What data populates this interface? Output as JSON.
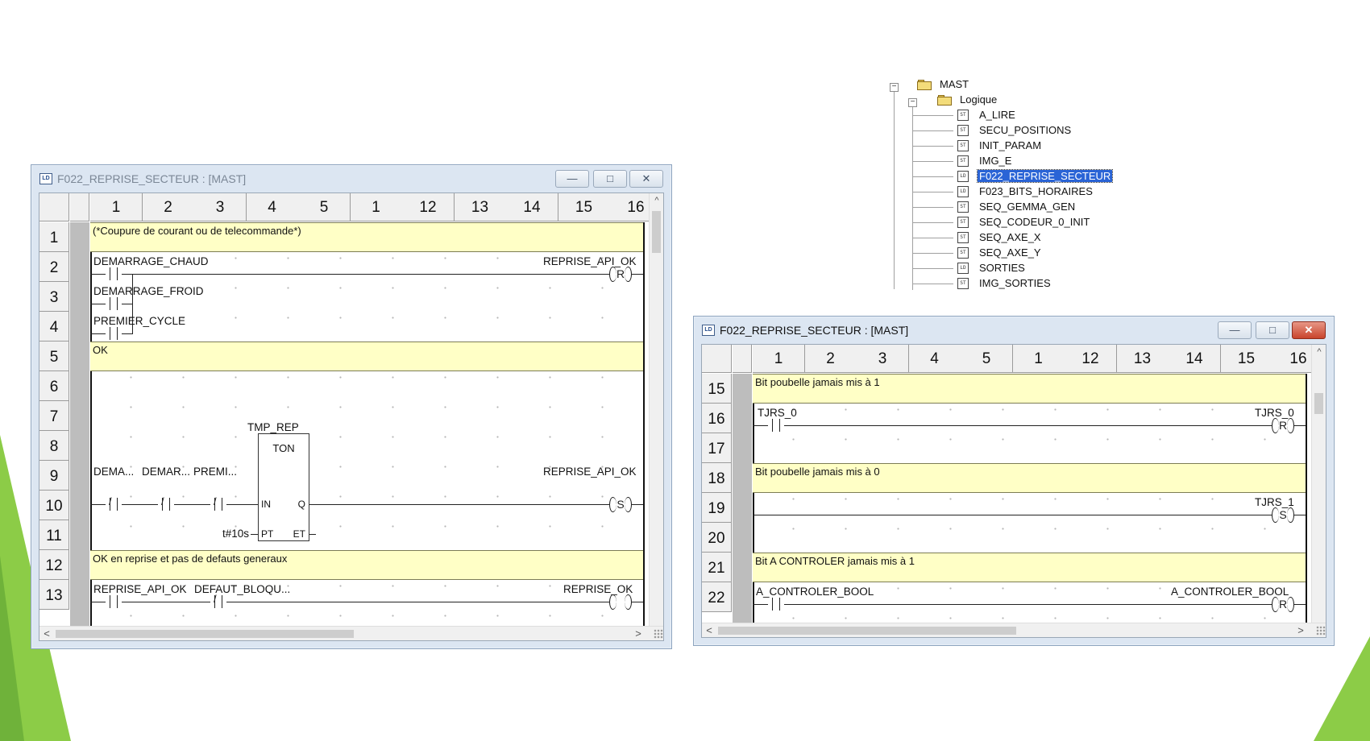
{
  "tree": {
    "items": [
      {
        "label": "MAST",
        "icon": "folder-icon",
        "level": 0,
        "expanded": true
      },
      {
        "label": "Logique",
        "icon": "folder-icon",
        "level": 1,
        "expanded": true
      },
      {
        "label": "A_LIRE",
        "icon": "st-section-icon",
        "level": 2
      },
      {
        "label": "SECU_POSITIONS",
        "icon": "st-section-icon",
        "level": 2
      },
      {
        "label": "INIT_PARAM",
        "icon": "st-section-icon",
        "level": 2
      },
      {
        "label": "IMG_E",
        "icon": "st-section-icon",
        "level": 2
      },
      {
        "label": "F022_REPRISE_SECTEUR",
        "icon": "ld-section-icon",
        "level": 2,
        "selected": true
      },
      {
        "label": "F023_BITS_HORAIRES",
        "icon": "ld-section-icon",
        "level": 2
      },
      {
        "label": "SEQ_GEMMA_GEN",
        "icon": "st-section-icon",
        "level": 2
      },
      {
        "label": "SEQ_CODEUR_0_INIT",
        "icon": "st-section-icon",
        "level": 2
      },
      {
        "label": "SEQ_AXE_X",
        "icon": "st-section-icon",
        "level": 2
      },
      {
        "label": "SEQ_AXE_Y",
        "icon": "st-section-icon",
        "level": 2
      },
      {
        "label": "SORTIES",
        "icon": "ld-section-icon",
        "level": 2
      },
      {
        "label": "IMG_SORTIES",
        "icon": "st-section-icon",
        "level": 2
      }
    ]
  },
  "icon_glyphs": {
    "st": "ST",
    "ld": "LD",
    "win": "LD",
    "minimize": "—",
    "maximize": "□",
    "close": "✕",
    "expand": "−",
    "scroll_up": "^",
    "scroll_left": "<",
    "scroll_right": ">"
  },
  "columns": [
    "1",
    "2",
    "3",
    "4",
    "5",
    "1",
    "12",
    "13",
    "14",
    "15",
    "16"
  ],
  "left_window": {
    "title": "F022_REPRISE_SECTEUR : [MAST]",
    "rows": [
      "1",
      "2",
      "3",
      "4",
      "5",
      "6",
      "7",
      "8",
      "9",
      "10",
      "11",
      "12",
      "13"
    ],
    "comments": [
      "(*Coupure de courant ou de telecommande*)",
      "OK",
      "OK en reprise et pas de defauts generaux"
    ],
    "vars": {
      "demarrage_chaud": "DEMARRAGE_CHAUD",
      "reprise_api_ok": "REPRISE_API_OK",
      "demarrage_froid": "DEMARRAGE_FROID",
      "premier_cycle": "PREMIER_CYCLE",
      "tmp_rep": "TMP_REP",
      "ton": "TON",
      "pin_in": "IN",
      "pin_q": "Q",
      "pin_pt": "PT",
      "pin_et": "ET",
      "dema": "DEMA...",
      "demar": "DEMAR...",
      "premi": "PREMI...",
      "reprise_api_ok_set": "REPRISE_API_OK",
      "preset": "t#10s",
      "reprise_api_ok_2": "REPRISE_API_OK",
      "defaut_bloqu": "DEFAUT_BLOQU...",
      "reprise_ok": "REPRISE_OK"
    },
    "coils": {
      "reset": "R",
      "set": "S",
      "plain": ""
    },
    "contact_neg": "/"
  },
  "right_window": {
    "title": "F022_REPRISE_SECTEUR : [MAST]",
    "rows": [
      "15",
      "16",
      "17",
      "18",
      "19",
      "20",
      "21",
      "22"
    ],
    "comments": [
      "Bit poubelle jamais mis à 1",
      "Bit poubelle jamais mis à 0",
      "Bit A CONTROLER jamais mis à 1"
    ],
    "vars": {
      "tjrs_0_contact": "TJRS_0",
      "tjrs_0_coil": "TJRS_0",
      "tjrs_1_coil": "TJRS_1",
      "a_controler_contact": "A_CONTROLER_BOOL",
      "a_controler_coil": "A_CONTROLER_BOOL"
    },
    "coils": {
      "reset": "R",
      "set": "S"
    }
  }
}
